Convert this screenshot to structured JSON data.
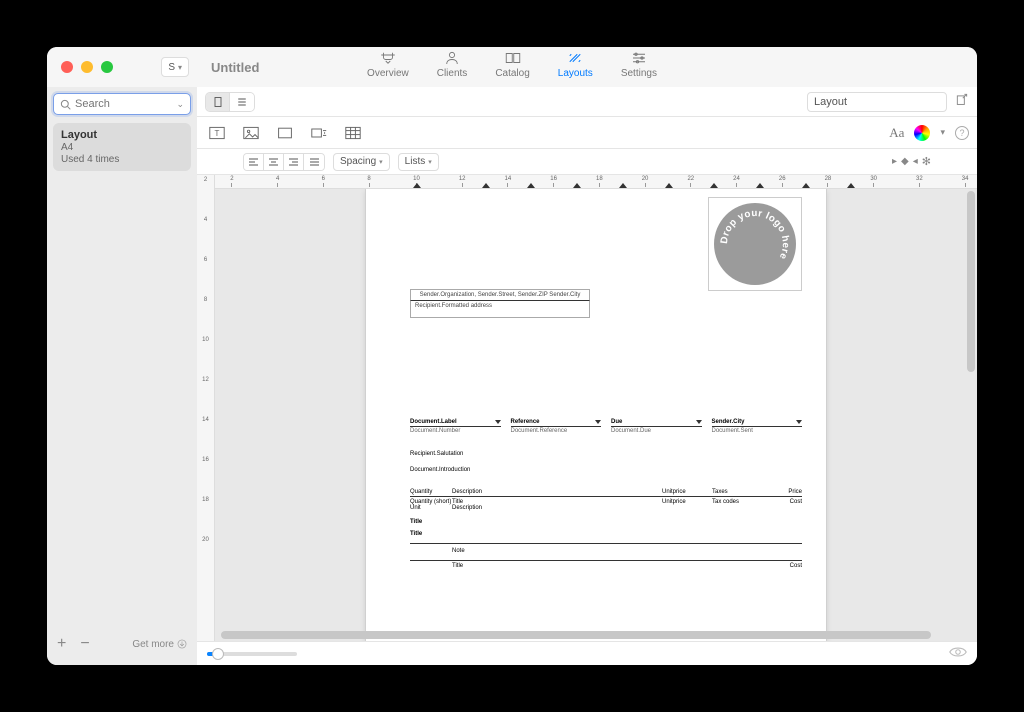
{
  "window": {
    "title": "Untitled",
    "account": "S"
  },
  "tabs": [
    {
      "id": "overview",
      "label": "Overview"
    },
    {
      "id": "clients",
      "label": "Clients"
    },
    {
      "id": "catalog",
      "label": "Catalog"
    },
    {
      "id": "layouts",
      "label": "Layouts",
      "active": true
    },
    {
      "id": "settings",
      "label": "Settings"
    }
  ],
  "sidebar": {
    "search_placeholder": "Search",
    "item": {
      "name": "Layout",
      "size": "A4",
      "usage": "Used 4 times"
    },
    "get_more": "Get more"
  },
  "toolbar": {
    "layout_name": "Layout",
    "spacing_label": "Spacing",
    "lists_label": "Lists",
    "aa_label": "Aa"
  },
  "ruler_h": [
    2,
    4,
    6,
    8,
    10,
    12,
    14,
    16,
    18,
    20,
    22,
    24,
    26,
    28,
    30,
    32,
    34
  ],
  "ruler_v": [
    2,
    4,
    6,
    8,
    10,
    12,
    14,
    16,
    18,
    20
  ],
  "doc": {
    "sender_line": "Sender.Organization, Sender.Street, Sender.ZIP Sender.City",
    "recipient_addr": "Recipient.Formatted address",
    "logo_text": "Drop your logo here",
    "meta": [
      {
        "h": "Document.Label",
        "v": "Document.Number"
      },
      {
        "h": "Reference",
        "v": "Document.Reference"
      },
      {
        "h": "Due",
        "v": "Document.Due"
      },
      {
        "h": "Sender.City",
        "v": "Document.Sent"
      }
    ],
    "salutation": "Recipient.Salutation",
    "introduction": "Document.Introduction",
    "table": {
      "headers": {
        "qty": "Quantity",
        "desc": "Description",
        "up": "Unitprice",
        "tax": "Taxes",
        "price": "Price"
      },
      "row1": {
        "qty": "Quantity (short) Unit",
        "desc": "Title\nDescription",
        "up": "Unitprice",
        "tax": "Tax codes",
        "price": "Cost"
      },
      "section_title_1": "Title",
      "section_title_2": "Title",
      "note": "Note",
      "footer": {
        "desc": "Title",
        "price": "Cost"
      }
    }
  }
}
